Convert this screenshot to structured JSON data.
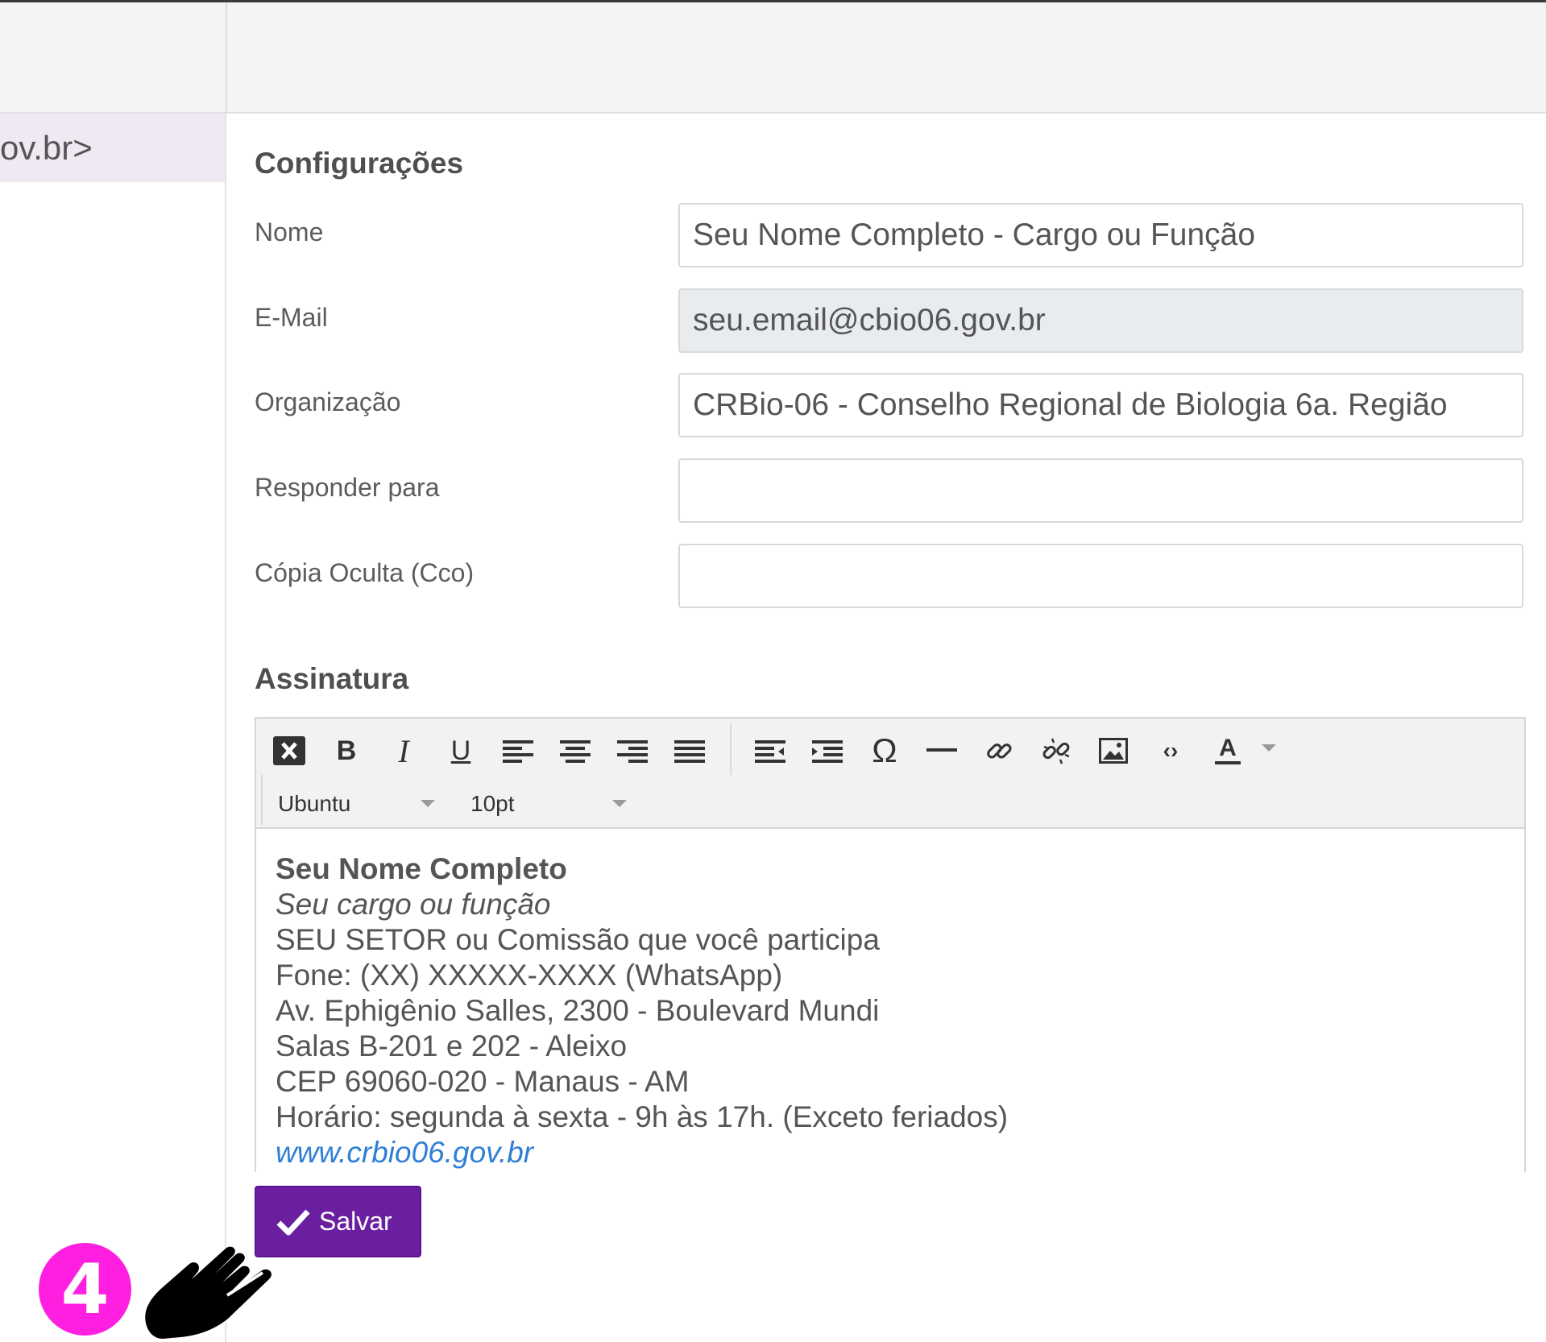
{
  "sidebar": {
    "selected_item": "ov.br>"
  },
  "settings": {
    "title": "Configurações",
    "fields": {
      "name": {
        "label": "Nome",
        "value": "Seu Nome Completo - Cargo ou Função"
      },
      "email": {
        "label": "E-Mail",
        "value": "seu.email@cbio06.gov.br"
      },
      "organization": {
        "label": "Organização",
        "value": "CRBio-06 - Conselho Regional de Biologia 6a. Região"
      },
      "reply_to": {
        "label": "Responder para",
        "value": ""
      },
      "bcc": {
        "label": "Cópia Oculta (Cco)",
        "value": ""
      }
    }
  },
  "signature": {
    "title": "Assinatura",
    "toolbar": {
      "font_family": "Ubuntu",
      "font_size": "10pt"
    },
    "lines": {
      "name": "Seu Nome Completo",
      "role": "Seu cargo ou função",
      "sector": "SEU SETOR ou Comissão que você participa",
      "phone": "Fone: (XX) XXXXX-XXXX (WhatsApp)",
      "address1": "Av. Ephigênio Salles, 2300 - Boulevard Mundi",
      "address2": "Salas B-201 e 202 - Aleixo",
      "address3": "CEP 69060-020 - Manaus - AM",
      "hours": "Horário: segunda à sexta - 9h às 17h. (Exceto feriados)",
      "website": "www.crbio06.gov.br"
    }
  },
  "actions": {
    "save_label": "Salvar"
  },
  "annotation": {
    "step_number": "4",
    "badge_color": "#ff1fe0"
  },
  "colors": {
    "primary": "#6a1fa0",
    "link": "#2f7fd6",
    "selected_row": "#efe9f4"
  }
}
